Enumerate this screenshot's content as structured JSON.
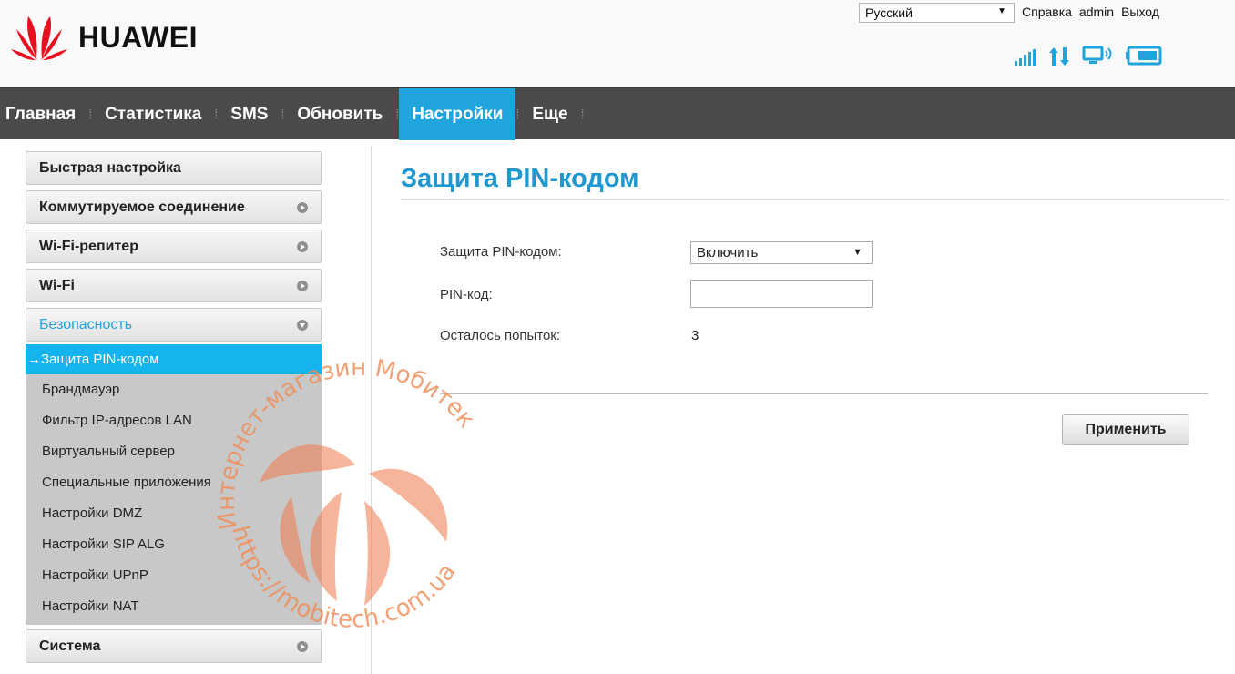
{
  "header": {
    "logo_text": "HUAWEI",
    "language": "Русский",
    "links": {
      "help": "Справка",
      "user": "admin",
      "logout": "Выход"
    },
    "status_icons": [
      "signal-icon",
      "data-transfer-icon",
      "wifi-device-icon",
      "battery-icon"
    ],
    "status_color": "#1fa4dc"
  },
  "nav": {
    "items": [
      {
        "label": "Главная"
      },
      {
        "label": "Статистика"
      },
      {
        "label": "SMS"
      },
      {
        "label": "Обновить"
      },
      {
        "label": "Настройки",
        "active": true
      },
      {
        "label": "Еще"
      }
    ],
    "accent": "#1fa4dc"
  },
  "sidebar": {
    "quick_setup": "Быстрая настройка",
    "dialup": "Коммутируемое соединение",
    "repeater": "Wi-Fi-репитер",
    "wifi": "Wi-Fi",
    "security": "Безопасность",
    "security_items": [
      "→Защита PIN-кодом",
      "Брандмауэр",
      "Фильтр IP-адресов LAN",
      "Виртуальный сервер",
      "Специальные приложения",
      "Настройки DMZ",
      "Настройки SIP ALG",
      "Настройки UPnP",
      "Настройки NAT"
    ],
    "system": "Система"
  },
  "main": {
    "title": "Защита PIN-кодом",
    "pin_protection_label": "Защита PIN-кодом:",
    "pin_protection_value": "Включить",
    "pin_code_label": "PIN-код:",
    "pin_code_value": "",
    "attempts_label": "Осталось попыток:",
    "attempts_value": "3",
    "apply_label": "Применить"
  },
  "watermark": {
    "text_top": "Интернет-магазин Мобитек",
    "text_bottom": "https://mobitech.com.ua"
  }
}
